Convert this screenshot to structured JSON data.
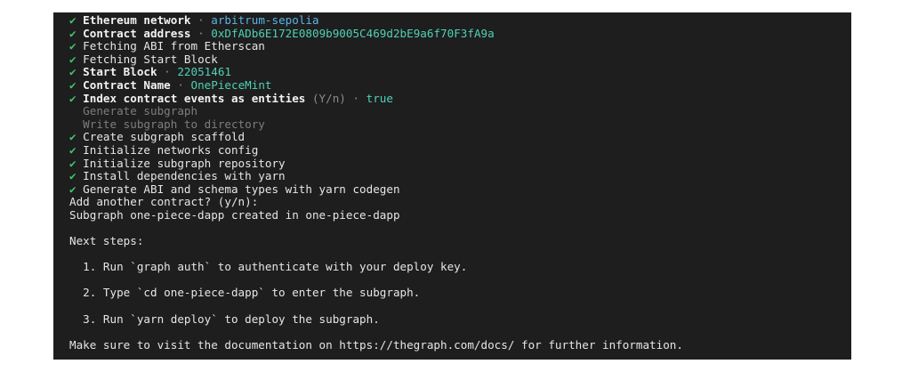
{
  "lines": {
    "network_label": "Ethereum network",
    "network_sep": " · ",
    "network_value": "arbitrum-sepolia",
    "address_label": "Contract address",
    "address_sep": " · ",
    "address_value": "0xDfADb6E172E0809b9005C469d2bE9a6f70F3fA9a",
    "fetch_abi": "Fetching ABI from Etherscan",
    "fetch_start": "Fetching Start Block",
    "start_label": "Start Block",
    "start_sep": " · ",
    "start_value": "22051461",
    "name_label": "Contract Name",
    "name_sep": " · ",
    "name_value": "OnePieceMint",
    "index_label": "Index contract events as entities",
    "index_hint": " (Y/n) · ",
    "index_value": "true",
    "gen_subgraph": "Generate subgraph",
    "write_subgraph": "Write subgraph to directory",
    "create_scaffold": "Create subgraph scaffold",
    "init_networks": "Initialize networks config",
    "init_repo": "Initialize subgraph repository",
    "install_deps": "Install dependencies with yarn",
    "gen_abi": "Generate ABI and schema types with yarn codegen",
    "add_another": "Add another contract? (y/n):",
    "created": "Subgraph one-piece-dapp created in one-piece-dapp",
    "next_steps": "Next steps:",
    "step1": "  1. Run `graph auth` to authenticate with your deploy key.",
    "step2": "  2. Type `cd one-piece-dapp` to enter the subgraph.",
    "step3": "  3. Run `yarn deploy` to deploy the subgraph.",
    "visit": "Make sure to visit the documentation on https://thegraph.com/docs/ for further information."
  },
  "check_glyph": "✔ ",
  "colors": {
    "background": "#1e1e1e",
    "check": "#3fc56b",
    "value": "#4fd1b5",
    "network_value": "#5ab4e6",
    "dim": "#8c8c8c"
  }
}
